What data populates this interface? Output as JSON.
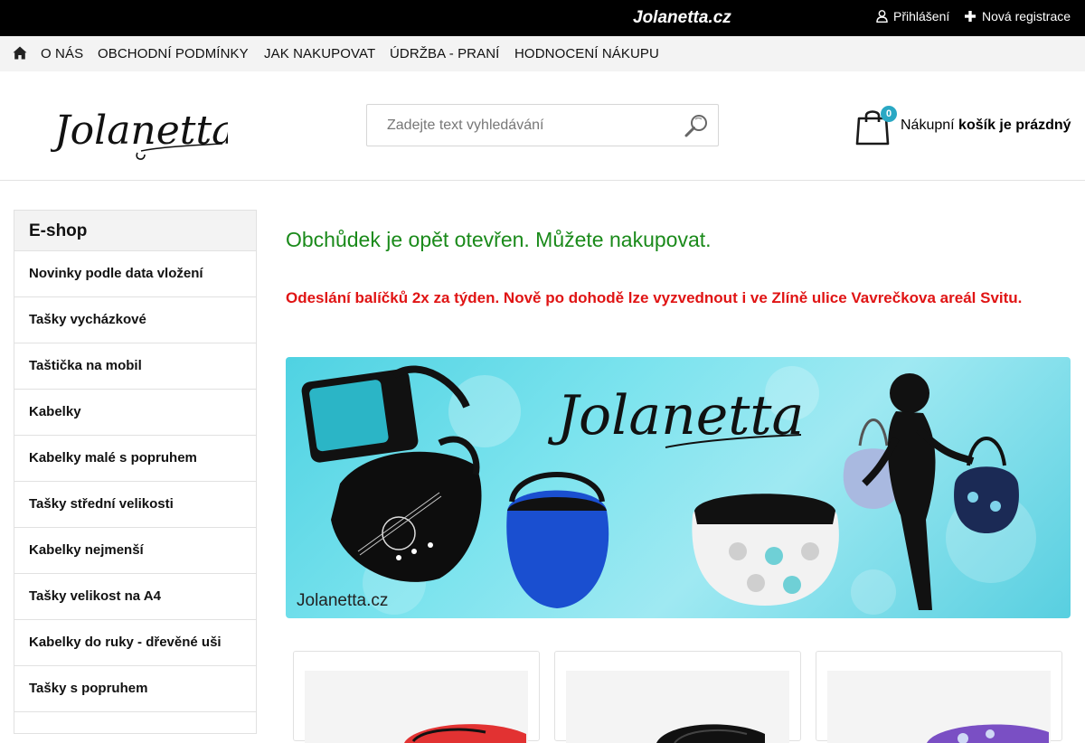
{
  "topbar": {
    "brand": "Jolanetta.cz",
    "login_label": "Přihlášení",
    "register_label": "Nová registrace"
  },
  "nav": {
    "items": [
      "O NÁS",
      "OBCHODNÍ PODMÍNKY",
      "JAK NAKUPOVAT",
      "ÚDRŽBA - PRANÍ",
      "HODNOCENÍ NÁKUPU"
    ]
  },
  "header": {
    "logo_text": "Jolanetta",
    "search_placeholder": "Zadejte text vyhledávání",
    "cart_count": "0",
    "cart_prefix": "Nákupní",
    "cart_status": "košík je prázdný"
  },
  "sidebar": {
    "title": "E-shop",
    "items": [
      "Novinky podle data vložení",
      "Tašky vycházkové",
      "Taštička na mobil",
      "Kabelky",
      "Kabelky malé s popruhem",
      "Tašky střední velikosti",
      "Kabelky nejmenší",
      "Tašky velikost na A4",
      "Kabelky do ruky - dřevěné uši",
      "Tašky s popruhem"
    ]
  },
  "main": {
    "notice_green": "Obchůdek je opět otevřen. Můžete nakupovat.",
    "notice_red": "Odeslání balíčků 2x za týden. Nově po dohodě lze vyzvednout i ve Zlíně ulice Vavrečkova areál Svitu.",
    "banner_logo": "Jolanetta",
    "banner_watermark": "Jolanetta.cz"
  },
  "colors": {
    "topbar_bg": "#000000",
    "nav_bg": "#f3f3f3",
    "green_notice": "#1a8a1a",
    "red_notice": "#e01414",
    "badge": "#2aa8c4",
    "banner": "#6fdcea"
  },
  "icons": {
    "home": "home-icon",
    "login": "user-icon",
    "register": "plus-icon",
    "search": "search-icon",
    "cart": "shopping-bag-icon"
  }
}
